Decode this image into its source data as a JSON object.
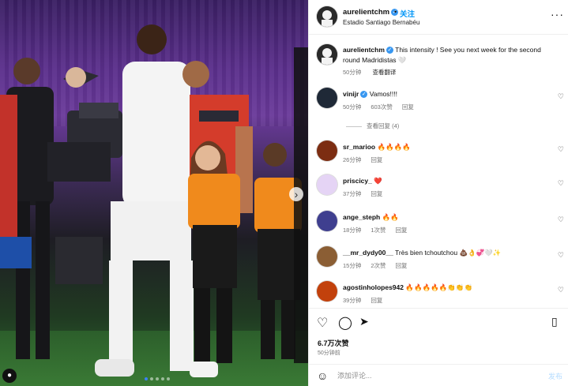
{
  "post": {
    "username": "aurelientchm",
    "follow_label": "关注",
    "location": "Estadio Santiago Bernabéu",
    "more_icon": "more-horizontal-icon"
  },
  "caption": {
    "username": "aurelientchm",
    "text": "This intensity ! See you next week for the second round Madridistas 🤍",
    "time": "50分钟",
    "translate": "查看翻译"
  },
  "comments": [
    {
      "username": "vinijr",
      "verified": true,
      "text": "Vamos!!!!",
      "time": "50分钟",
      "likes": "603次赞",
      "reply": "回复",
      "view_replies": "查看回复 (4)",
      "avatar_color": "#1f2937"
    },
    {
      "username": "sr_marioo",
      "verified": false,
      "text": "🔥🔥🔥🔥",
      "time": "26分钟",
      "likes": "",
      "reply": "回复",
      "avatar_color": "#7c2d12"
    },
    {
      "username": "priscicy_",
      "verified": false,
      "text": "❤️",
      "time": "37分钟",
      "likes": "",
      "reply": "回复",
      "avatar_color": "#e5d4f5"
    },
    {
      "username": "ange_steph",
      "verified": false,
      "text": "🔥🔥",
      "time": "18分钟",
      "likes": "1次赞",
      "reply": "回复",
      "avatar_color": "#3f3f8f"
    },
    {
      "username": "__mr_dydy00__",
      "verified": false,
      "text": "Très bien tchoutchou 💩👌💞🤍✨",
      "time": "15分钟",
      "likes": "2次赞",
      "reply": "回复",
      "avatar_color": "#8b5e34"
    },
    {
      "username": "agostinholopes942",
      "verified": false,
      "text": "🔥🔥🔥🔥🔥👏👏👏",
      "time": "39分钟",
      "likes": "",
      "reply": "回复",
      "avatar_color": "#c2410c"
    }
  ],
  "actions": {
    "like_icon": "heart-icon",
    "comment_icon": "comment-icon",
    "share_icon": "share-icon",
    "save_icon": "bookmark-icon",
    "likes_count": "6.7万次赞",
    "posted_time": "50分钟前"
  },
  "composer": {
    "placeholder": "添加评论...",
    "post_label": "发布"
  },
  "colors": {
    "accent": "#0095f6",
    "verified": "#3897f0",
    "muted": "#737373"
  }
}
